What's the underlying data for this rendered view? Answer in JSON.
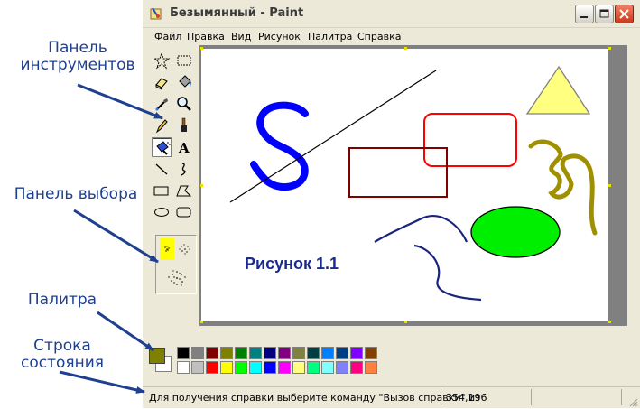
{
  "annotations": {
    "toolbox_label": [
      "Панель",
      "инструментов"
    ],
    "options_label": "Панель выбора",
    "palette_label": "Палитра",
    "statusbar_label": [
      "Строка",
      "состояния"
    ]
  },
  "window": {
    "title": "Безымянный - Paint",
    "controls": [
      "minimize",
      "maximize",
      "close"
    ]
  },
  "menu": [
    "Файл",
    "Правка",
    "Вид",
    "Рисунок",
    "Палитра",
    "Справка"
  ],
  "tools": [
    {
      "name": "free-select",
      "icon": "star-select-icon"
    },
    {
      "name": "rect-select",
      "icon": "rect-select-icon"
    },
    {
      "name": "eraser",
      "icon": "eraser-icon"
    },
    {
      "name": "fill",
      "icon": "fill-bucket-icon"
    },
    {
      "name": "pick-color",
      "icon": "eyedropper-icon"
    },
    {
      "name": "magnifier",
      "icon": "magnifier-icon"
    },
    {
      "name": "pencil",
      "icon": "pencil-icon"
    },
    {
      "name": "brush",
      "icon": "brush-icon"
    },
    {
      "name": "airbrush",
      "icon": "airbrush-icon",
      "selected": true
    },
    {
      "name": "text",
      "icon": "text-icon",
      "glyph": "A"
    },
    {
      "name": "line",
      "icon": "line-icon"
    },
    {
      "name": "curve",
      "icon": "curve-icon"
    },
    {
      "name": "rectangle",
      "icon": "rectangle-icon"
    },
    {
      "name": "polygon",
      "icon": "polygon-icon"
    },
    {
      "name": "ellipse",
      "icon": "ellipse-icon"
    },
    {
      "name": "rounded-rect",
      "icon": "rounded-rect-icon"
    }
  ],
  "drawing": {
    "caption": "Рисунок 1.1",
    "caption_color": "#1a2b8f"
  },
  "palette": {
    "foreground": "#808000",
    "background": "#ffffff",
    "row1": [
      "#000000",
      "#808080",
      "#800000",
      "#808000",
      "#008000",
      "#008080",
      "#000080",
      "#800080",
      "#808040",
      "#004040",
      "#0080ff",
      "#004080",
      "#8000ff",
      "#804000"
    ],
    "row2": [
      "#ffffff",
      "#c0c0c0",
      "#ff0000",
      "#ffff00",
      "#00ff00",
      "#00ffff",
      "#0000ff",
      "#ff00ff",
      "#ffff80",
      "#00ff80",
      "#80ffff",
      "#8080ff",
      "#ff0080",
      "#ff8040"
    ]
  },
  "status": {
    "help_text": "Для получения справки выберите команду \"Вызов справки\" из",
    "coords": "354,196"
  }
}
